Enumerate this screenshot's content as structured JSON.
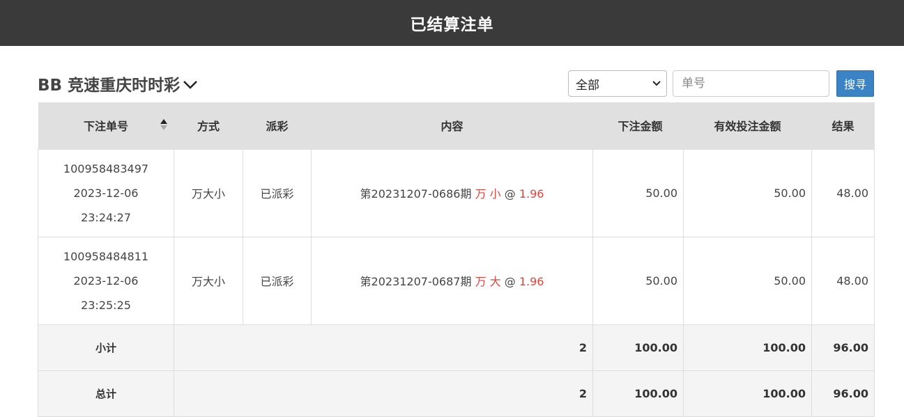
{
  "header": {
    "title": "已结算注单"
  },
  "game": {
    "title": "BB 竞速重庆时时彩"
  },
  "filter": {
    "selected": "全部"
  },
  "search": {
    "placeholder": "单号",
    "value": "",
    "button_label": "搜寻"
  },
  "table": {
    "columns": [
      "下注单号",
      "方式",
      "派彩",
      "内容",
      "下注金额",
      "有效投注金额",
      "结果"
    ],
    "rows": [
      {
        "order_no": "100958483497",
        "date": "2023-12-06",
        "time": "23:24:27",
        "method": "万大小",
        "payout": "已派彩",
        "content_prefix": "第20231207-0686期",
        "pick": "万 小",
        "at": "@",
        "odds": "1.96",
        "bet_amount": "50.00",
        "valid_amount": "50.00",
        "result": "48.00"
      },
      {
        "order_no": "100958484811",
        "date": "2023-12-06",
        "time": "23:25:25",
        "method": "万大小",
        "payout": "已派彩",
        "content_prefix": "第20231207-0687期",
        "pick": "万 大",
        "at": "@",
        "odds": "1.96",
        "bet_amount": "50.00",
        "valid_amount": "50.00",
        "result": "48.00"
      }
    ],
    "subtotal": {
      "label": "小计",
      "count": "2",
      "bet_amount": "100.00",
      "valid_amount": "100.00",
      "result": "96.00"
    },
    "total": {
      "label": "总计",
      "count": "2",
      "bet_amount": "100.00",
      "valid_amount": "100.00",
      "result": "96.00"
    }
  },
  "colors": {
    "header_bg": "#3a3a3a",
    "button": "#3a83c4",
    "highlight": "#e0453c"
  },
  "icons": {
    "title_dropdown": "chevron-down-icon",
    "sort": "sort-icon",
    "select": "chevron-down-icon"
  }
}
